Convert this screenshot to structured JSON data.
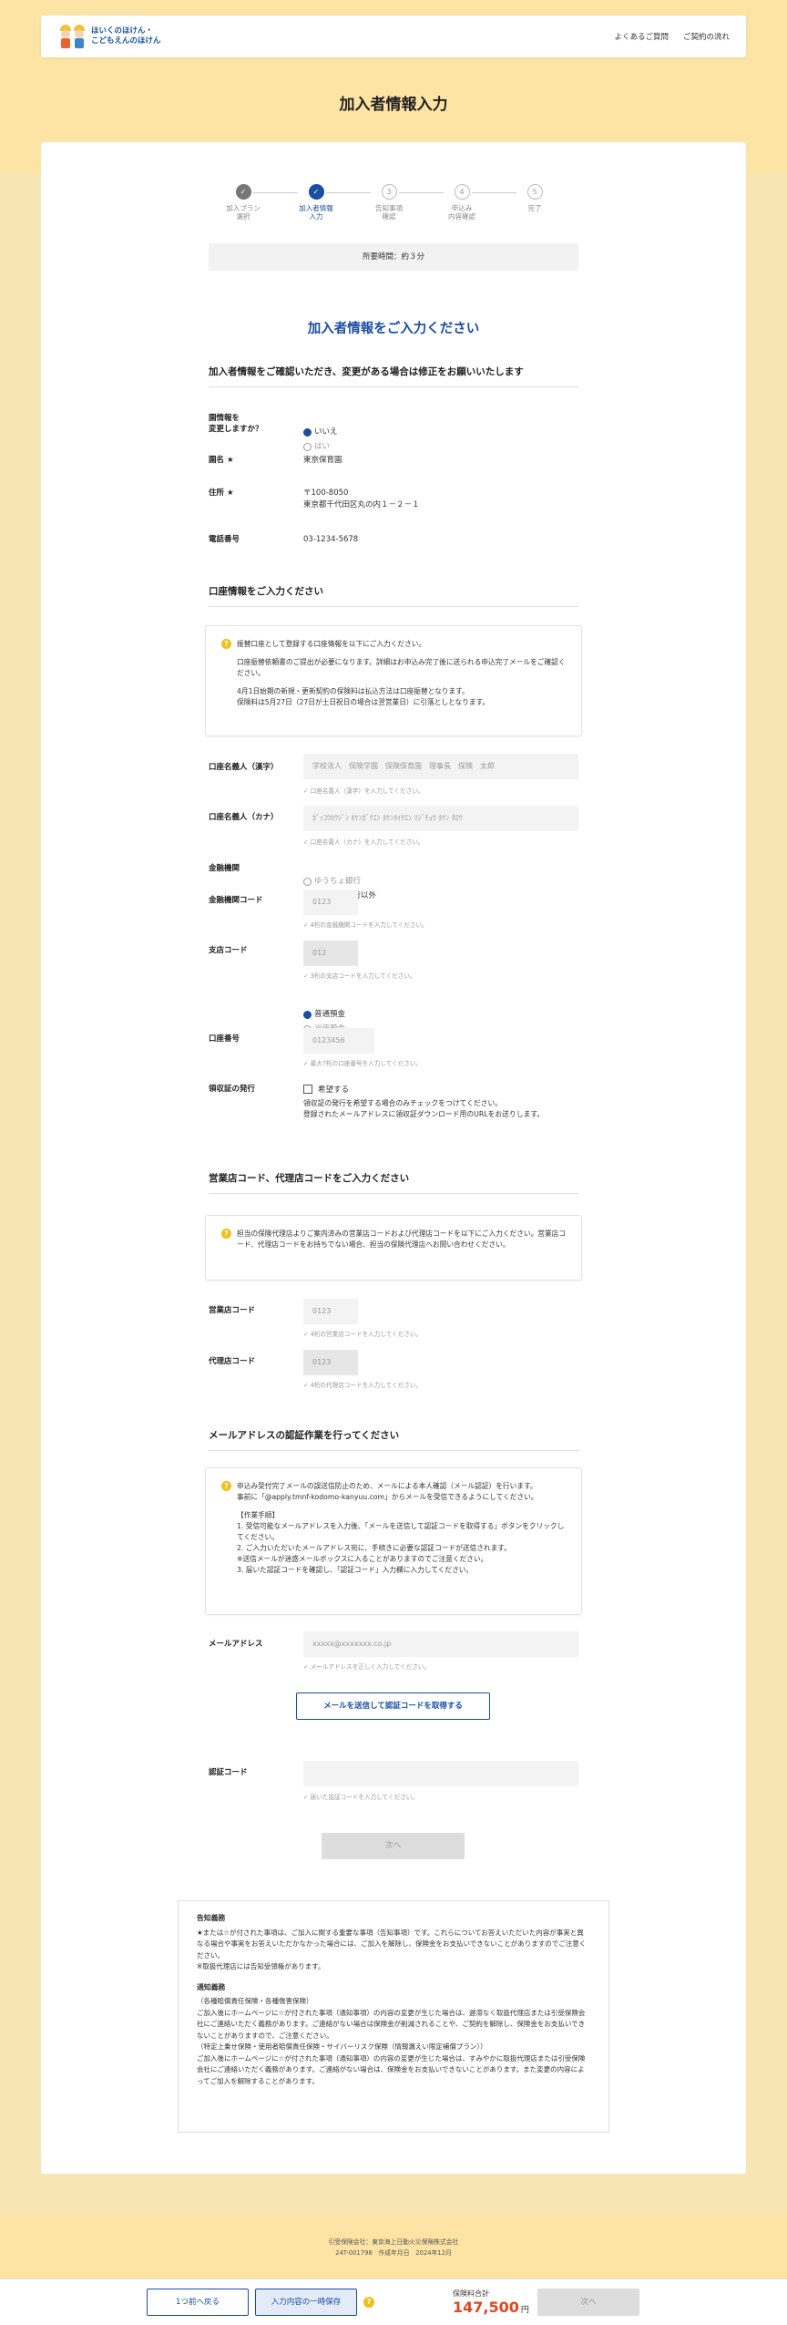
{
  "header": {
    "logo_line1": "ほいくのほけん・",
    "logo_line2": "こどもえんのほけん",
    "nav_faq": "よくあるご質問",
    "nav_flow": "ご契約の流れ"
  },
  "page_title": "加入者情報入力",
  "steps": [
    {
      "num": "✓",
      "label": "加入プラン\n選択"
    },
    {
      "num": "✓",
      "label": "加入者情報\n入力"
    },
    {
      "num": "3",
      "label": "告知事項\n確認"
    },
    {
      "num": "4",
      "label": "申込み\n内容確認"
    },
    {
      "num": "5",
      "label": "完了"
    }
  ],
  "time_required": "所要時間：約３分",
  "main_heading": "加入者情報をご入力ください",
  "section1": {
    "title": "加入者情報をご確認いただき、変更がある場合は修正をお願いいたします",
    "change_label": "園情報を\n変更しますか？",
    "radio_no": "いいえ",
    "radio_yes": "はい",
    "name_label": "園名 ★",
    "name_value": "東京保育園",
    "address_label": "住所 ★",
    "address_value": "〒100-8050\n東京都千代田区丸の内１－２－１",
    "phone_label": "電話番号",
    "phone_value": "03-1234-5678"
  },
  "section2": {
    "title": "口座情報をご入力ください",
    "notice_p1": "振替口座として登録する口座情報を以下にご入力ください。",
    "notice_p2": "口座振替依頼書のご提出が必要になります。詳細はお申込み完了後に送られる申込完了メールをご確認ください。",
    "notice_p3": "4月1日始期の新規・更新契約の保険料は払込方法は口座振替となります。\n保険料は5月27日（27日が土日祝日の場合は翌営業日）に引落としとなります。",
    "holder_kanji_label": "口座名義人（漢字）",
    "holder_kanji_placeholder": "学校法人　保険学園　保険保育園　理事長　保険　太郎",
    "holder_kanji_hint": "✓ 口座名義人（漢字）を入力してください。",
    "holder_kana_label": "口座名義人（カナ）",
    "holder_kana_placeholder": "ｶﾞｯｺｳﾎｳｼﾞﾝ ﾎｹﾝｶﾞｸｴﾝ ﾎｹﾝﾎｲｸｴﾝ ﾘｼﾞﾁｮｳ ﾎｹﾝ ﾀﾛｳ",
    "holder_kana_hint": "✓ 口座名義人（カナ）を入力してください。",
    "bank_label": "金融機関",
    "bank_opt1": "ゆうちょ銀行",
    "bank_opt2": "ゆうちょ銀行以外",
    "bank_code_label": "金融機関コード",
    "bank_code_placeholder": "0123",
    "bank_code_hint": "✓ 4桁の金融機関コードを入力してください。",
    "branch_code_label": "支店コード",
    "branch_code_placeholder": "012",
    "branch_code_hint": "✓ 3桁の支店コードを入力してください。",
    "acct_type1": "普通預金",
    "acct_type2": "当座預金",
    "acct_no_label": "口座番号",
    "acct_no_placeholder": "0123456",
    "acct_no_hint": "✓ 最大7桁の口座番号を入力してください。",
    "receipt_label": "領収証の発行",
    "receipt_check": "希望する",
    "receipt_note": "領収証の発行を希望する場合のみチェックをつけてください。\n登録されたメールアドレスに領収証ダウンロード用のURLをお送りします。"
  },
  "section3": {
    "title": "営業店コード、代理店コードをご入力ください",
    "notice": "担当の保険代理店よりご案内済みの営業店コードおよび代理店コードを以下にご入力ください。営業店コード、代理店コードをお持ちでない場合、担当の保険代理店へお問い合わせください。",
    "sales_label": "営業店コード",
    "sales_placeholder": "0123",
    "sales_hint": "✓ 4桁の営業店コードを入力してください。",
    "agent_label": "代理店コード",
    "agent_placeholder": "0123",
    "agent_hint": "✓ 4桁の代理店コードを入力してください。"
  },
  "section4": {
    "title": "メールアドレスの認証作業を行ってください",
    "notice_p1": "申込み受付完了メールの誤送信防止のため、メールによる本人確認（メール認証）を行います。\n事前に「@apply.tmnf-kodomo-kanyuu.com」からメールを受信できるようにしてください。",
    "notice_p2": "【作業手順】\n1. 受信可能なメールアドレスを入力後、「メールを送信して認証コードを取得する」ボタンをクリックしてください。\n2. ご入力いただいたメールアドレス宛に、手続きに必要な認証コードが送信されます。\n※送信メールが迷惑メールボックスに入ることがありますのでご注意ください。\n3. 届いた認証コードを確認し、「認証コード」入力欄に入力してください。",
    "email_label": "メールアドレス",
    "email_placeholder": "xxxxx@xxxxxxx.co.jp",
    "email_hint": "✓ メールアドレスを正しく入力してください。",
    "send_button": "メールを送信して認証コードを取得する",
    "code_label": "認証コード",
    "code_hint": "✓ 届いた認証コードを入力してください。",
    "next_button": "次へ"
  },
  "disclaimer": {
    "h1": "告知義務",
    "t1": "★または☆が付された事項は、ご加入に関する重要な事項（告知事項）です。これらについてお答えいただいた内容が事実と異なる場合や事実をお答えいただかなかった場合には、ご加入を解除し、保険金をお支払いできないことがありますのでご注意ください。\n※取扱代理店には告知受領権があります。",
    "h2": "通知義務",
    "t2": "（各種賠償責任保険・各種傷害保険）\nご加入後にホームページに☆が付された事項（通知事項）の内容の変更が生じた場合は、遅滞なく取扱代理店または引受保険会社にご連絡いただく義務があります。ご連絡がない場合は保険金が削減されることや、ご契約を解除し、保険金をお支払いできないことがありますので、ご注意ください。\n（特定上乗せ保険・使用者賠償責任保険・サイバーリスク保険（情報漏えい限定補償プラン））\nご加入後にホームページに☆が付された事項（通知事項）の内容の変更が生じた場合は、すみやかに取扱代理店または引受保険会社にご連絡いただく義務があります。ご連絡がない場合は、保険金をお支払いできないことがあります。また変更の内容によってご加入を解除することがあります。"
  },
  "footer": {
    "line1": "引受保険会社：東京海上日動火災保険株式会社",
    "line2": "24T-001798　作成年月日　2024年12月"
  },
  "bottom_bar": {
    "back": "1つ前へ戻る",
    "save": "入力内容の一時保存",
    "total_label": "保険料合計",
    "total_value": "147,500",
    "yen": "円",
    "next": "次へ"
  },
  "colors": {
    "accent": "#1a4ea2",
    "price": "#e0451f",
    "band": "#fde4a4",
    "bg": "#f7e6b3"
  }
}
